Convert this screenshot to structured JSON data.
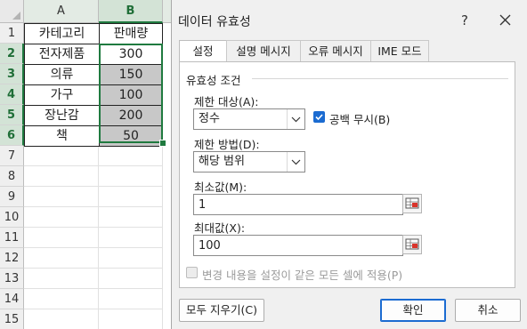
{
  "sheet": {
    "columns": [
      "A",
      "B"
    ],
    "rows": [
      "1",
      "2",
      "3",
      "4",
      "5",
      "6",
      "7",
      "8",
      "9",
      "10",
      "11",
      "12",
      "13",
      "14",
      "15"
    ],
    "cells": [
      {
        "a": "카테고리",
        "b": "판매량"
      },
      {
        "a": "전자제품",
        "b": "300"
      },
      {
        "a": "의류",
        "b": "150"
      },
      {
        "a": "가구",
        "b": "100"
      },
      {
        "a": "장난감",
        "b": "200"
      },
      {
        "a": "책",
        "b": "50"
      }
    ],
    "colors": {
      "header_selected": "#d3e3d6",
      "selection": "#1f7a3f",
      "range_fill": "#c8c8c8"
    }
  },
  "dialog": {
    "title": "데이터 유효성",
    "help": "?",
    "tabs": [
      "설정",
      "설명 메시지",
      "오류 메시지",
      "IME 모드"
    ],
    "active_tab": "설정",
    "group_label": "유효성 조건",
    "allow_label": "제한 대상(A):",
    "allow_value": "정수",
    "ignore_blank_label": "공백 무시(B)",
    "ignore_blank_checked": true,
    "data_label": "제한 방법(D):",
    "data_value": "해당 범위",
    "min_label": "최소값(M):",
    "min_value": "1",
    "max_label": "최대값(X):",
    "max_value": "100",
    "apply_all_label": "변경 내용을 설정이 같은 모든 셀에 적용(P)",
    "apply_all_checked": false,
    "clear_all_label": "모두 지우기(C)",
    "ok_label": "확인",
    "cancel_label": "취소",
    "accent_color": "#1b6bd1"
  }
}
